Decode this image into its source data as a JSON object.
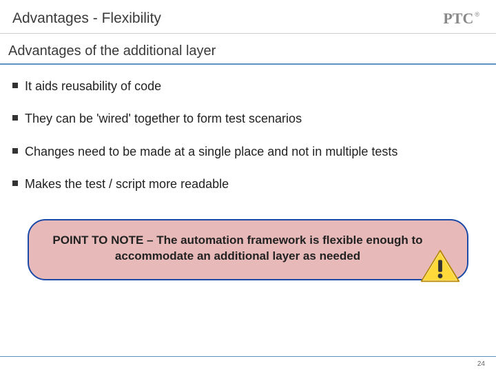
{
  "header": {
    "title": "Advantages - Flexibility",
    "logo_text": "PTC",
    "logo_reg": "®"
  },
  "subtitle": "Advantages of the additional layer",
  "bullets": [
    "It aids reusability of code",
    "They can be 'wired' together to form test scenarios",
    "Changes need to be made at a single place and not in multiple tests",
    "Makes the test / script more readable"
  ],
  "callout": {
    "text": "POINT TO NOTE – The automation framework is flexible enough to accommodate an additional layer as needed"
  },
  "page_number": "24"
}
